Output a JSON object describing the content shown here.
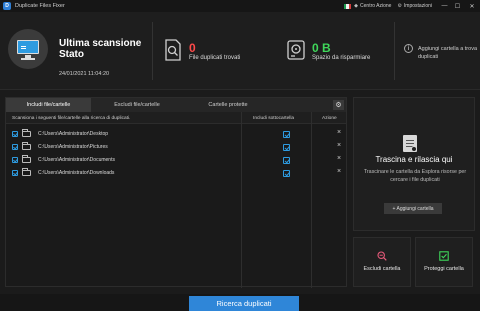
{
  "window": {
    "title": "Duplicate Files Fixer",
    "app_icon_letter": "D",
    "centro_azione": "Centro Azione",
    "impostazioni": "Impostazioni",
    "minimize": "—",
    "maximize": "☐",
    "close": "✕"
  },
  "header": {
    "scan_title": "Ultima scansione Stato",
    "scan_date": "24/01/2021 11:04:20",
    "dup_count": "0",
    "dup_label": "File duplicati trovati",
    "savings": "0 B",
    "savings_label": "Spazio da risparmiare",
    "info_icon": "i",
    "info_text": "Aggiungi cartella a trova duplicati"
  },
  "tabs": [
    {
      "label": "Includi file/cartelle",
      "active": true
    },
    {
      "label": "Escludi file/cartelle",
      "active": false
    },
    {
      "label": "Cartelle protette",
      "active": false
    }
  ],
  "gear_icon": "⚙",
  "table": {
    "headers": {
      "path": "Scansiona i seguenti file/cartelle alla ricerca di duplicati.",
      "sub": "Includi sottocartella",
      "action": "Azione"
    },
    "rows": [
      {
        "path": "C:\\Users\\Administrator\\Desktop"
      },
      {
        "path": "C:\\Users\\Administrator\\Pictures"
      },
      {
        "path": "C:\\Users\\Administrator\\Documents"
      },
      {
        "path": "C:\\Users\\Administrator\\Downloads"
      }
    ],
    "delete_glyph": "×"
  },
  "drop": {
    "title": "Trascina e rilascia qui",
    "desc": "Trascinare le cartella da Esplora risorse per cercare i file duplicati",
    "add_button": "+ Aggiungi cartella"
  },
  "cards": {
    "exclude": "Escludi cartella",
    "protect": "Proteggi cartella"
  },
  "scan_button": "Ricerca duplicati",
  "colors": {
    "accent": "#2f86d8",
    "red": "#ff4a4a",
    "green": "#3fd75a"
  }
}
